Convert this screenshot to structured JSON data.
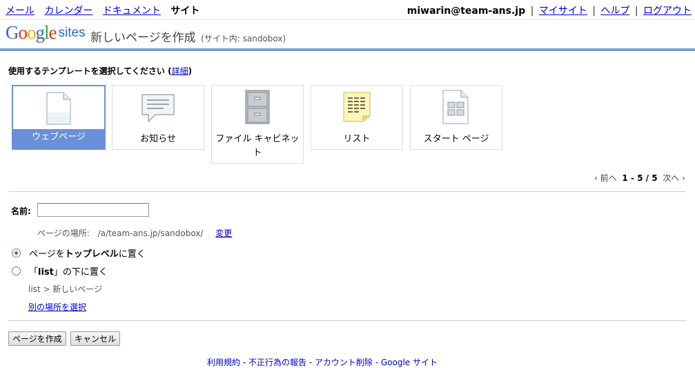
{
  "topnav": {
    "links": [
      "メール",
      "カレンダー",
      "ドキュメント"
    ],
    "current": "サイト",
    "user": "miwarin@team-ans.jp",
    "right_links": [
      "マイサイト",
      "ヘルプ",
      "ログアウト"
    ]
  },
  "header": {
    "logo_text": "Google",
    "logo_sub": "sites",
    "title": "新しいページを作成",
    "context": "(サイト内: sandobox)"
  },
  "templates": {
    "prompt": "使用するテンプレートを選択してください",
    "details_link": "詳細",
    "items": [
      {
        "label": "ウェブページ",
        "icon": "web-page-icon",
        "selected": true
      },
      {
        "label": "お知らせ",
        "icon": "announcement-icon",
        "selected": false
      },
      {
        "label": "ファイル キャビネット",
        "icon": "file-cabinet-icon",
        "selected": false
      },
      {
        "label": "リスト",
        "icon": "list-icon",
        "selected": false
      },
      {
        "label": "スタート ページ",
        "icon": "start-page-icon",
        "selected": false
      }
    ],
    "pager": {
      "prev": "‹ 前へ",
      "range": "1 - 5 / 5",
      "next": "次へ ›"
    }
  },
  "form": {
    "name_label": "名前:",
    "name_value": "",
    "location_label": "ページの場所:",
    "location_path": "/a/team-ans.jp/sandobox/",
    "change_link": "変更",
    "option_top_prefix": "ページを",
    "option_top_bold": "トップレベル",
    "option_top_suffix": "に置く",
    "option_under_prefix": "「",
    "option_under_bold": "list",
    "option_under_suffix": "」の下に置く",
    "breadcrumb": "list > 新しいページ",
    "other_location_link": "別の場所を選択",
    "create_button": "ページを作成",
    "cancel_button": "キャンセル"
  },
  "colors": {
    "accent": "#6b90da",
    "header_rule": "#7b9bd9",
    "link": "#0000cc",
    "radio_checked": "#2f9b2f"
  },
  "footer": {
    "text": "利用規約 - 不正行為の報告 - アカウント削除 - Google サイト"
  }
}
